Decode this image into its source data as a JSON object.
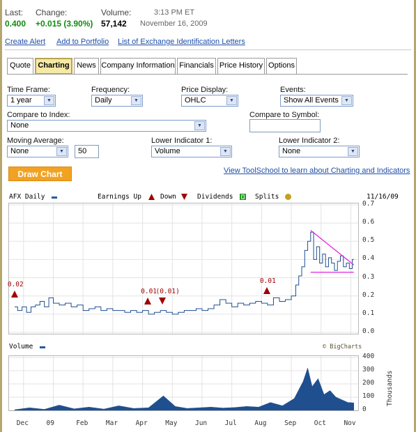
{
  "quote": {
    "last_label": "Last:",
    "last_value": "0.400",
    "change_label": "Change:",
    "change_value": "+0.015 (3.90%)",
    "volume_label": "Volume:",
    "volume_value": "57,142",
    "time": "3:13 PM ET",
    "date": "November 16, 2009"
  },
  "links": [
    "Create Alert",
    "Add to Portfolio",
    "List of Exchange Identification Letters"
  ],
  "tabs": [
    "Quote",
    "Charting",
    "News",
    "Company Information",
    "Financials",
    "Price History",
    "Options"
  ],
  "active_tab": "Charting",
  "form": {
    "timeframe_label": "Time Frame:",
    "timeframe_value": "1 year",
    "frequency_label": "Frequency:",
    "frequency_value": "Daily",
    "price_display_label": "Price Display:",
    "price_display_value": "OHLC",
    "events_label": "Events:",
    "events_value": "Show All Events",
    "compare_index_label": "Compare to Index:",
    "compare_index_value": "None",
    "compare_symbol_label": "Compare to Symbol:",
    "compare_symbol_value": "",
    "moving_average_label": "Moving Average:",
    "moving_average_value": "None",
    "moving_average_period": "50",
    "lower1_label": "Lower Indicator 1:",
    "lower1_value": "Volume",
    "lower2_label": "Lower Indicator 2:",
    "lower2_value": "None",
    "draw_button": "Draw Chart",
    "toolschool_link": "View ToolSchool to learn about Charting and Indicators"
  },
  "colors": {
    "accent_orange": "#f2a223",
    "link_blue": "#1f4fa8",
    "gain_green": "#128a12",
    "price_line": "#1f4f8f",
    "trend_magenta": "#e020e0",
    "event_red": "#a00000"
  },
  "chart_data": {
    "type": "line",
    "header": {
      "symbol_label": "AFX Daily",
      "earnings_up": "Earnings Up",
      "down": "Down",
      "dividends": "Dividends",
      "splits": "Splits",
      "date": "11/16/09",
      "copyright": "© BigCharts",
      "volume_label": "Volume"
    },
    "y_ticks": [
      "0.7",
      "0.6",
      "0.5",
      "0.4",
      "0.3",
      "0.2",
      "0.1",
      "0.0"
    ],
    "ylim": [
      0,
      0.7
    ],
    "volume_ticks": [
      "400",
      "300",
      "200",
      "100",
      "0"
    ],
    "volume_ylim": [
      0,
      400
    ],
    "volume_unit": "Thousands",
    "x_ticks": [
      "Dec",
      "09",
      "Feb",
      "Mar",
      "Apr",
      "May",
      "Jun",
      "Jul",
      "Aug",
      "Sep",
      "Oct",
      "Nov"
    ],
    "events": [
      {
        "label": "0.02",
        "type": "earnings-up",
        "x": 0.02
      },
      {
        "label": "0.01",
        "type": "earnings-up",
        "x": 4.5
      },
      {
        "label": "(0.01)",
        "type": "earnings-down",
        "x": 5.0
      },
      {
        "label": "0.01",
        "type": "earnings-up",
        "x": 8.5
      }
    ],
    "price_series": [
      [
        0.0,
        0.14
      ],
      [
        0.1,
        0.12
      ],
      [
        0.25,
        0.14
      ],
      [
        0.4,
        0.11
      ],
      [
        0.55,
        0.14
      ],
      [
        0.7,
        0.15
      ],
      [
        0.85,
        0.17
      ],
      [
        1.0,
        0.14
      ],
      [
        1.15,
        0.19
      ],
      [
        1.3,
        0.16
      ],
      [
        1.5,
        0.15
      ],
      [
        1.7,
        0.16
      ],
      [
        1.9,
        0.14
      ],
      [
        2.1,
        0.15
      ],
      [
        2.3,
        0.12
      ],
      [
        2.5,
        0.13
      ],
      [
        2.7,
        0.14
      ],
      [
        2.9,
        0.12
      ],
      [
        3.1,
        0.13
      ],
      [
        3.3,
        0.12
      ],
      [
        3.5,
        0.12
      ],
      [
        3.7,
        0.11
      ],
      [
        3.9,
        0.12
      ],
      [
        4.1,
        0.11
      ],
      [
        4.3,
        0.12
      ],
      [
        4.5,
        0.1
      ],
      [
        4.7,
        0.11
      ],
      [
        4.9,
        0.12
      ],
      [
        5.1,
        0.11
      ],
      [
        5.3,
        0.1
      ],
      [
        5.5,
        0.11
      ],
      [
        5.7,
        0.12
      ],
      [
        5.9,
        0.12
      ],
      [
        6.1,
        0.13
      ],
      [
        6.3,
        0.12
      ],
      [
        6.5,
        0.13
      ],
      [
        6.7,
        0.15
      ],
      [
        6.9,
        0.18
      ],
      [
        7.1,
        0.16
      ],
      [
        7.3,
        0.14
      ],
      [
        7.5,
        0.16
      ],
      [
        7.7,
        0.15
      ],
      [
        7.9,
        0.16
      ],
      [
        8.1,
        0.17
      ],
      [
        8.3,
        0.16
      ],
      [
        8.5,
        0.15
      ],
      [
        8.7,
        0.19
      ],
      [
        8.9,
        0.17
      ],
      [
        9.1,
        0.18
      ],
      [
        9.3,
        0.2
      ],
      [
        9.45,
        0.26
      ],
      [
        9.55,
        0.31
      ],
      [
        9.65,
        0.36
      ],
      [
        9.75,
        0.45
      ],
      [
        9.85,
        0.5
      ],
      [
        9.95,
        0.55
      ],
      [
        10.05,
        0.4
      ],
      [
        10.15,
        0.47
      ],
      [
        10.25,
        0.38
      ],
      [
        10.35,
        0.43
      ],
      [
        10.45,
        0.36
      ],
      [
        10.55,
        0.41
      ],
      [
        10.65,
        0.38
      ],
      [
        10.75,
        0.34
      ],
      [
        10.85,
        0.39
      ],
      [
        10.95,
        0.42
      ],
      [
        11.05,
        0.36
      ],
      [
        11.15,
        0.38
      ],
      [
        11.25,
        0.35
      ],
      [
        11.35,
        0.4
      ],
      [
        11.4,
        0.4
      ]
    ],
    "trendlines": [
      {
        "name": "resistance",
        "points": [
          [
            9.95,
            0.56
          ],
          [
            11.4,
            0.37
          ]
        ]
      },
      {
        "name": "support",
        "points": [
          [
            9.95,
            0.33
          ],
          [
            11.4,
            0.33
          ]
        ]
      }
    ],
    "volume_series": [
      [
        0.0,
        5
      ],
      [
        0.5,
        20
      ],
      [
        1.0,
        8
      ],
      [
        1.5,
        40
      ],
      [
        2.0,
        12
      ],
      [
        2.5,
        25
      ],
      [
        3.0,
        10
      ],
      [
        3.5,
        35
      ],
      [
        4.0,
        15
      ],
      [
        4.5,
        20
      ],
      [
        5.0,
        110
      ],
      [
        5.4,
        30
      ],
      [
        5.8,
        15
      ],
      [
        6.2,
        20
      ],
      [
        6.6,
        25
      ],
      [
        7.0,
        18
      ],
      [
        7.4,
        22
      ],
      [
        7.8,
        30
      ],
      [
        8.2,
        25
      ],
      [
        8.6,
        60
      ],
      [
        9.0,
        35
      ],
      [
        9.4,
        90
      ],
      [
        9.7,
        220
      ],
      [
        9.85,
        320
      ],
      [
        10.0,
        180
      ],
      [
        10.2,
        240
      ],
      [
        10.4,
        120
      ],
      [
        10.6,
        150
      ],
      [
        10.8,
        100
      ],
      [
        11.0,
        80
      ],
      [
        11.2,
        60
      ],
      [
        11.4,
        57
      ]
    ],
    "grid": true
  }
}
